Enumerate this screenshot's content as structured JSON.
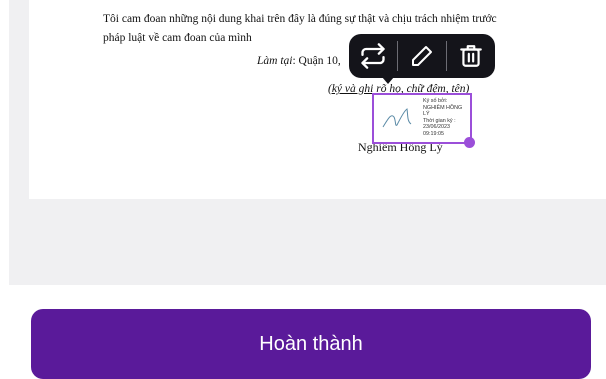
{
  "document": {
    "line1": "Tôi cam đoan những nội dung khai trên đây là đúng sự thật và chịu trách nhiệm trước",
    "line2": "pháp luật về cam đoan của mình",
    "place_label": "Làm tại",
    "place_value": ": Quận 10,",
    "sign_hint": "(ký và ghi rõ họ, chữ đệm, tên)",
    "signer_name": "Nghiêm Hồng Lý"
  },
  "signature": {
    "info": "Ký số bởi:\nNGHIÊM HỒNG\nLÝ\nThời gian ký :\n23/06/2023\n09:19:05",
    "accent_color": "#9b4fd9"
  },
  "toolbar": {
    "icons": [
      "swap-icon",
      "pencil-icon",
      "trash-icon"
    ]
  },
  "actions": {
    "done_label": "Hoàn thành",
    "done_color": "#5a1a9a"
  }
}
